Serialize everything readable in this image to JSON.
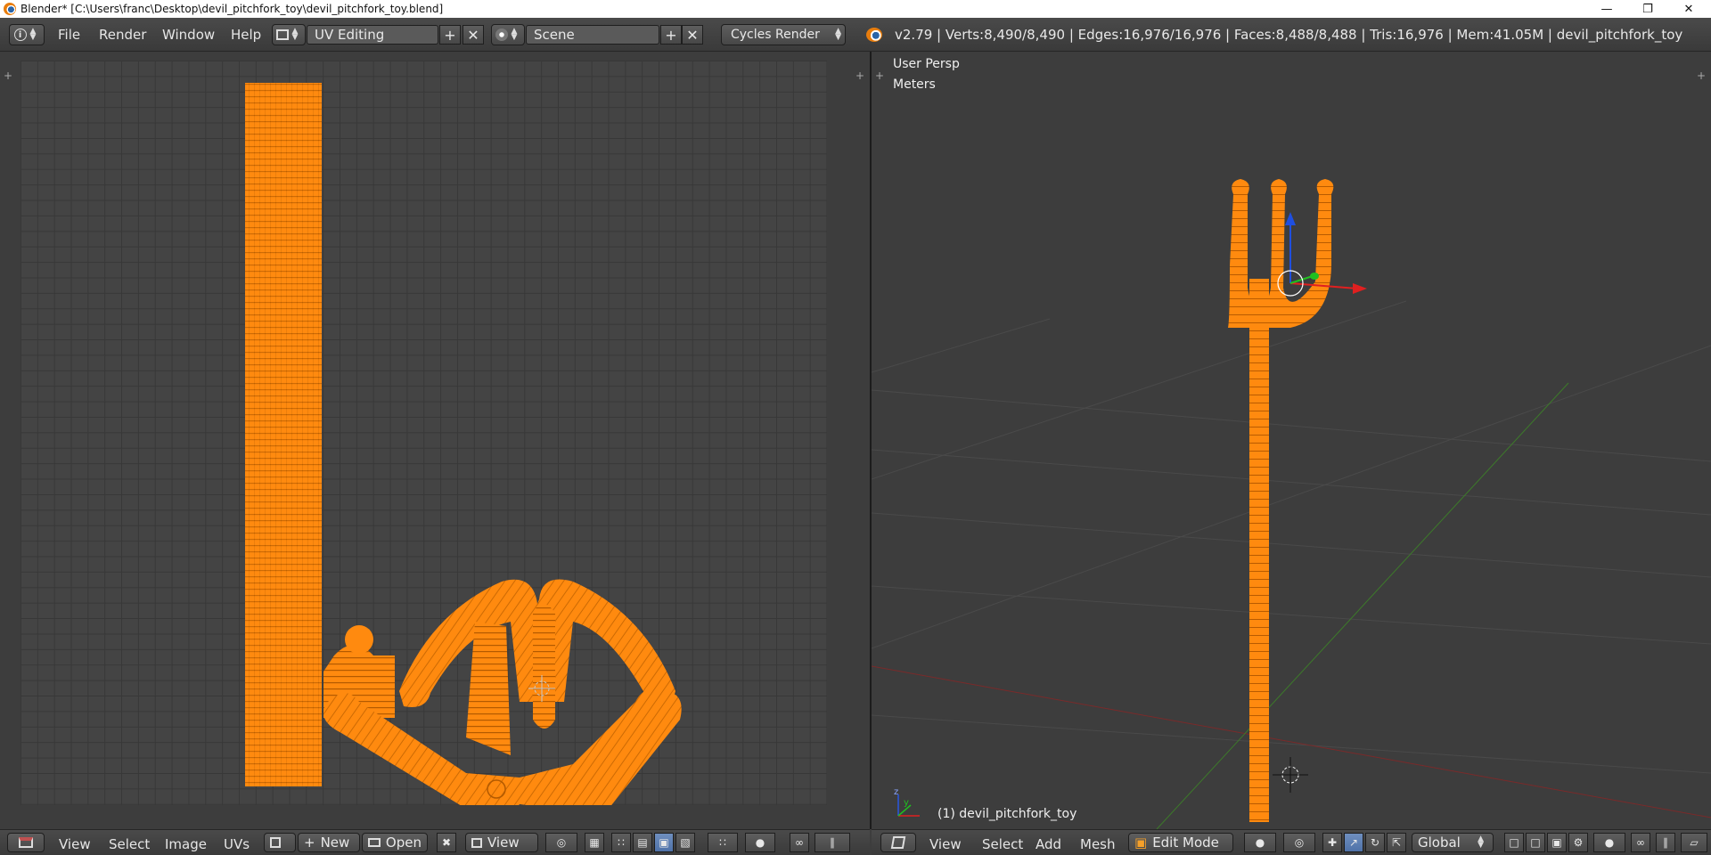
{
  "window": {
    "title": "Blender* [C:\\Users\\franc\\Desktop\\devil_pitchfork_toy\\devil_pitchfork_toy.blend]",
    "controls": [
      "minimize",
      "restore",
      "close"
    ]
  },
  "info_header": {
    "menus": [
      "File",
      "Render",
      "Window",
      "Help"
    ],
    "screen_layout": "UV Editing",
    "scene": "Scene",
    "render_engine": "Cycles Render",
    "stats": "v2.79 | Verts:8,490/8,490 | Edges:16,976/16,976 | Faces:8,488/8,488 | Tris:16,976 | Mem:41.05M | devil_pitchfork_toy"
  },
  "viewport": {
    "view_name": "User Persp",
    "units": "Meters",
    "object_label": "(1) devil_pitchfork_toy"
  },
  "uv_header": {
    "menus": [
      "View",
      "Select",
      "Image",
      "UVs"
    ],
    "new_label": "New",
    "open_label": "Open",
    "view_label": "View"
  },
  "view3d_header": {
    "menus": [
      "View",
      "Select",
      "Add",
      "Mesh"
    ],
    "mode": "Edit Mode",
    "orientation": "Global"
  },
  "colors": {
    "mesh_orange": "#ff8a0f",
    "background": "#3d3d3d",
    "grid_line": "#383838"
  },
  "icons": [
    "info-icon",
    "screen-layout-icon",
    "scene-icon",
    "blender-logo-icon",
    "image-editor-icon",
    "3d-view-icon",
    "pin-icon",
    "uv-sync-icon",
    "pivot-icon",
    "manipulator-icon"
  ]
}
